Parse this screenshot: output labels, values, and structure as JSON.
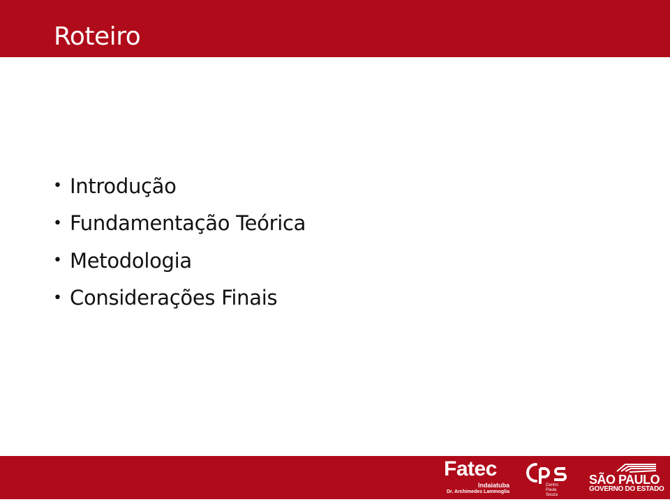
{
  "slide": {
    "title": "Roteiro",
    "bullet_glyph": "•",
    "items": [
      {
        "label": "Introdução"
      },
      {
        "label": "Fundamentação Teórica"
      },
      {
        "label": "Metodologia"
      },
      {
        "label": "Considerações Finais"
      }
    ]
  },
  "footer": {
    "fatec": {
      "name": "Fatec",
      "campus": "Indaiatuba",
      "patron": "Dr. Archimedes Lammoglia"
    },
    "cps": {
      "line1": "Centro",
      "line2": "Paula Souza"
    },
    "sp": {
      "name": "SÃO PAULO",
      "sub": "GOVERNO DO ESTADO"
    }
  },
  "colors": {
    "brand_red": "#b00b1a",
    "text": "#111111",
    "background": "#ffffff"
  }
}
